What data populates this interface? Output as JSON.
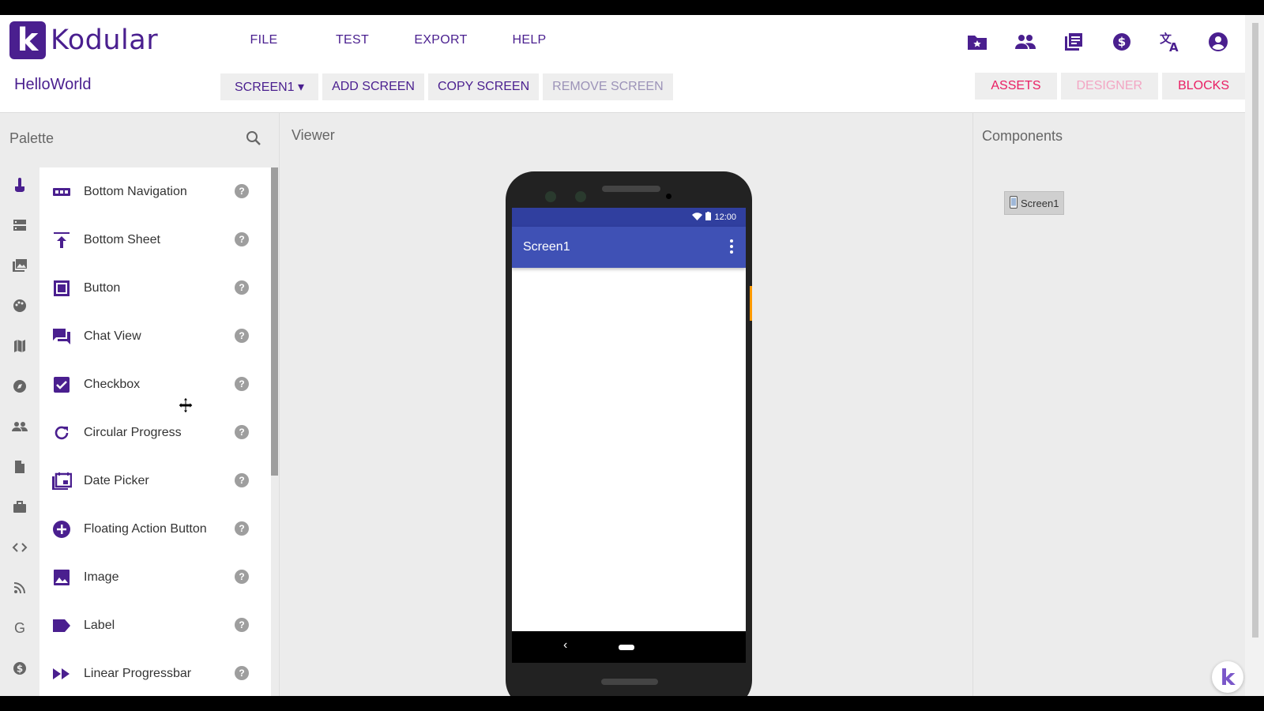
{
  "app": {
    "logo_letter": "k",
    "name": "Kodular",
    "menu": [
      "FILE",
      "TEST",
      "EXPORT",
      "HELP"
    ],
    "top_icons": [
      "project-folder-icon",
      "people-icon",
      "library-icon",
      "dollar-icon",
      "translate-icon",
      "account-icon"
    ],
    "accent_color": "#4a1f8f",
    "pink_color": "#e91e63"
  },
  "project": {
    "name": "HelloWorld"
  },
  "screen_bar": {
    "screen_select": "SCREEN1 ▾",
    "add": "ADD SCREEN",
    "copy": "COPY SCREEN",
    "remove": "REMOVE SCREEN"
  },
  "view_bar": {
    "assets": "ASSETS",
    "designer": "DESIGNER",
    "blocks": "BLOCKS"
  },
  "palette": {
    "title": "Palette",
    "categories": [
      "touch-icon",
      "layout-icon",
      "media-icon",
      "palette-icon",
      "map-icon",
      "compass-icon",
      "social-icon",
      "document-icon",
      "briefcase-icon",
      "code-icon",
      "rss-icon",
      "google-icon",
      "monetization-icon"
    ],
    "items": [
      {
        "label": "Bottom Navigation",
        "icon": "bottom-navigation-icon"
      },
      {
        "label": "Bottom Sheet",
        "icon": "bottom-sheet-icon"
      },
      {
        "label": "Button",
        "icon": "button-icon"
      },
      {
        "label": "Chat View",
        "icon": "chat-view-icon"
      },
      {
        "label": "Checkbox",
        "icon": "checkbox-icon"
      },
      {
        "label": "Circular Progress",
        "icon": "circular-progress-icon"
      },
      {
        "label": "Date Picker",
        "icon": "date-picker-icon"
      },
      {
        "label": "Floating Action Button",
        "icon": "floating-action-button-icon"
      },
      {
        "label": "Image",
        "icon": "image-icon"
      },
      {
        "label": "Label",
        "icon": "label-icon"
      },
      {
        "label": "Linear Progressbar",
        "icon": "linear-progressbar-icon"
      }
    ],
    "help_glyph": "?"
  },
  "viewer": {
    "title": "Viewer",
    "status_time": "12:00",
    "screen_title": "Screen1",
    "nav_back": "‹"
  },
  "components": {
    "title": "Components",
    "root": "Screen1"
  }
}
